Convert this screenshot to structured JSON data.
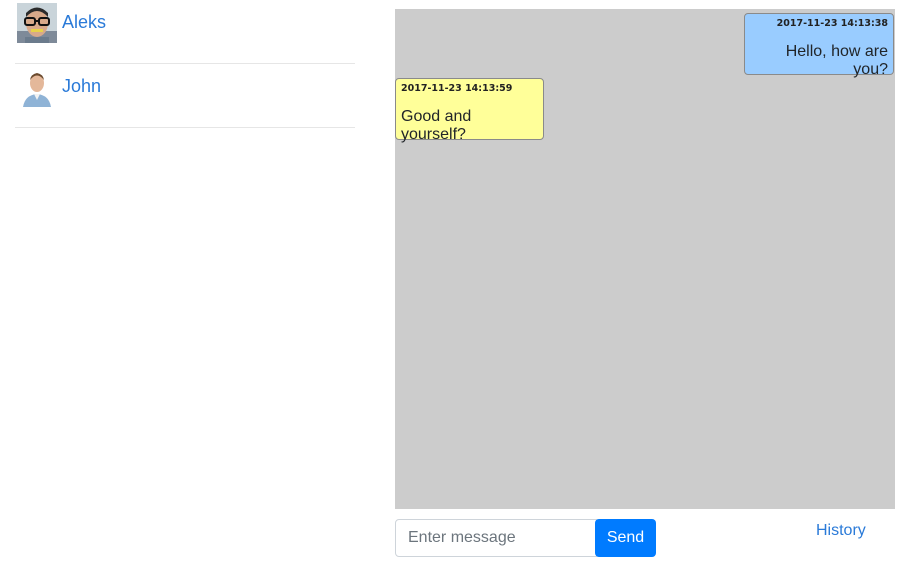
{
  "contacts": [
    {
      "name": "Aleks",
      "avatar": "avatar-aleks"
    },
    {
      "name": "John",
      "avatar": "avatar-john"
    }
  ],
  "messages": [
    {
      "direction": "outgoing",
      "timestamp": "2017-11-23 14:13:38",
      "text": "Hello, how are you?",
      "color": "#99ccff"
    },
    {
      "direction": "incoming",
      "timestamp": "2017-11-23 14:13:59",
      "text": "Good and yourself?",
      "color": "#ffff99"
    }
  ],
  "composer": {
    "placeholder": "Enter message",
    "value": "",
    "send_label": "Send"
  },
  "history_link": "History",
  "colors": {
    "chat_background": "#cccccc",
    "primary": "#007bff",
    "link": "#2a7ad8"
  }
}
